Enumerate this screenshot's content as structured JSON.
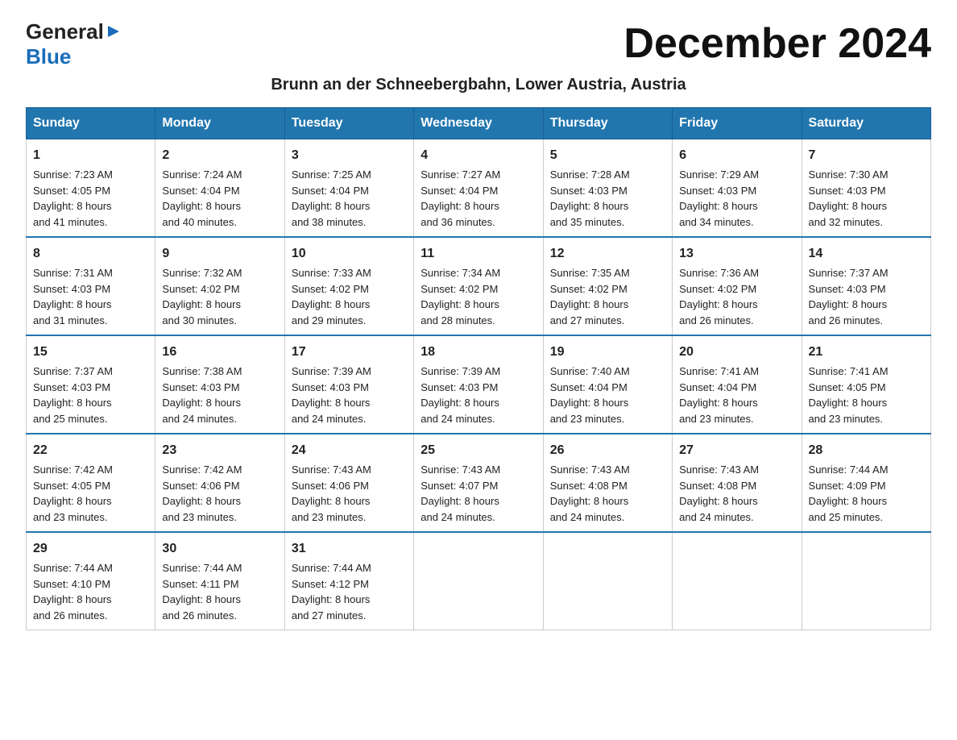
{
  "header": {
    "title": "December 2024",
    "subtitle": "Brunn an der Schneebergbahn, Lower Austria, Austria",
    "logo_general": "General",
    "logo_blue": "Blue"
  },
  "columns": [
    "Sunday",
    "Monday",
    "Tuesday",
    "Wednesday",
    "Thursday",
    "Friday",
    "Saturday"
  ],
  "weeks": [
    [
      {
        "day": "1",
        "sunrise": "7:23 AM",
        "sunset": "4:05 PM",
        "daylight": "8 hours and 41 minutes."
      },
      {
        "day": "2",
        "sunrise": "7:24 AM",
        "sunset": "4:04 PM",
        "daylight": "8 hours and 40 minutes."
      },
      {
        "day": "3",
        "sunrise": "7:25 AM",
        "sunset": "4:04 PM",
        "daylight": "8 hours and 38 minutes."
      },
      {
        "day": "4",
        "sunrise": "7:27 AM",
        "sunset": "4:04 PM",
        "daylight": "8 hours and 36 minutes."
      },
      {
        "day": "5",
        "sunrise": "7:28 AM",
        "sunset": "4:03 PM",
        "daylight": "8 hours and 35 minutes."
      },
      {
        "day": "6",
        "sunrise": "7:29 AM",
        "sunset": "4:03 PM",
        "daylight": "8 hours and 34 minutes."
      },
      {
        "day": "7",
        "sunrise": "7:30 AM",
        "sunset": "4:03 PM",
        "daylight": "8 hours and 32 minutes."
      }
    ],
    [
      {
        "day": "8",
        "sunrise": "7:31 AM",
        "sunset": "4:03 PM",
        "daylight": "8 hours and 31 minutes."
      },
      {
        "day": "9",
        "sunrise": "7:32 AM",
        "sunset": "4:02 PM",
        "daylight": "8 hours and 30 minutes."
      },
      {
        "day": "10",
        "sunrise": "7:33 AM",
        "sunset": "4:02 PM",
        "daylight": "8 hours and 29 minutes."
      },
      {
        "day": "11",
        "sunrise": "7:34 AM",
        "sunset": "4:02 PM",
        "daylight": "8 hours and 28 minutes."
      },
      {
        "day": "12",
        "sunrise": "7:35 AM",
        "sunset": "4:02 PM",
        "daylight": "8 hours and 27 minutes."
      },
      {
        "day": "13",
        "sunrise": "7:36 AM",
        "sunset": "4:02 PM",
        "daylight": "8 hours and 26 minutes."
      },
      {
        "day": "14",
        "sunrise": "7:37 AM",
        "sunset": "4:03 PM",
        "daylight": "8 hours and 26 minutes."
      }
    ],
    [
      {
        "day": "15",
        "sunrise": "7:37 AM",
        "sunset": "4:03 PM",
        "daylight": "8 hours and 25 minutes."
      },
      {
        "day": "16",
        "sunrise": "7:38 AM",
        "sunset": "4:03 PM",
        "daylight": "8 hours and 24 minutes."
      },
      {
        "day": "17",
        "sunrise": "7:39 AM",
        "sunset": "4:03 PM",
        "daylight": "8 hours and 24 minutes."
      },
      {
        "day": "18",
        "sunrise": "7:39 AM",
        "sunset": "4:03 PM",
        "daylight": "8 hours and 24 minutes."
      },
      {
        "day": "19",
        "sunrise": "7:40 AM",
        "sunset": "4:04 PM",
        "daylight": "8 hours and 23 minutes."
      },
      {
        "day": "20",
        "sunrise": "7:41 AM",
        "sunset": "4:04 PM",
        "daylight": "8 hours and 23 minutes."
      },
      {
        "day": "21",
        "sunrise": "7:41 AM",
        "sunset": "4:05 PM",
        "daylight": "8 hours and 23 minutes."
      }
    ],
    [
      {
        "day": "22",
        "sunrise": "7:42 AM",
        "sunset": "4:05 PM",
        "daylight": "8 hours and 23 minutes."
      },
      {
        "day": "23",
        "sunrise": "7:42 AM",
        "sunset": "4:06 PM",
        "daylight": "8 hours and 23 minutes."
      },
      {
        "day": "24",
        "sunrise": "7:43 AM",
        "sunset": "4:06 PM",
        "daylight": "8 hours and 23 minutes."
      },
      {
        "day": "25",
        "sunrise": "7:43 AM",
        "sunset": "4:07 PM",
        "daylight": "8 hours and 24 minutes."
      },
      {
        "day": "26",
        "sunrise": "7:43 AM",
        "sunset": "4:08 PM",
        "daylight": "8 hours and 24 minutes."
      },
      {
        "day": "27",
        "sunrise": "7:43 AM",
        "sunset": "4:08 PM",
        "daylight": "8 hours and 24 minutes."
      },
      {
        "day": "28",
        "sunrise": "7:44 AM",
        "sunset": "4:09 PM",
        "daylight": "8 hours and 25 minutes."
      }
    ],
    [
      {
        "day": "29",
        "sunrise": "7:44 AM",
        "sunset": "4:10 PM",
        "daylight": "8 hours and 26 minutes."
      },
      {
        "day": "30",
        "sunrise": "7:44 AM",
        "sunset": "4:11 PM",
        "daylight": "8 hours and 26 minutes."
      },
      {
        "day": "31",
        "sunrise": "7:44 AM",
        "sunset": "4:12 PM",
        "daylight": "8 hours and 27 minutes."
      },
      null,
      null,
      null,
      null
    ]
  ],
  "labels": {
    "sunrise": "Sunrise:",
    "sunset": "Sunset:",
    "daylight": "Daylight:"
  }
}
